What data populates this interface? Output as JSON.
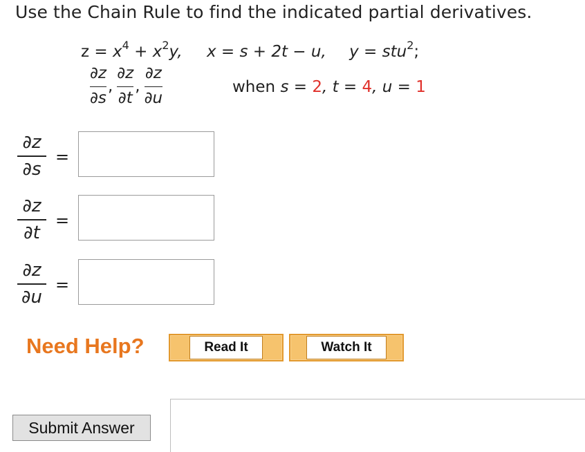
{
  "prompt": "Use the Chain Rule to find the indicated partial derivatives.",
  "given": {
    "z_lhs": "z = ",
    "z_x": "x",
    "z_exp4": "4",
    "z_plus": " + ",
    "z_x2": "x",
    "z_exp2": "2",
    "z_y": "y,",
    "x_def": "x = s + 2t − u,",
    "y_def_lhs": "y = ",
    "y_def_stu": "stu",
    "y_def_exp": "2",
    "y_def_end": ";"
  },
  "partials": {
    "dz": "∂z",
    "ds": "∂s",
    "dt": "∂t",
    "du": "∂u",
    "comma": ","
  },
  "when": {
    "label": "when ",
    "s_lbl": "s = ",
    "s_val": "2",
    "t_lbl": ", t = ",
    "t_val": "4",
    "u_lbl": ", u = ",
    "u_val": "1"
  },
  "answers": [
    {
      "num": "∂z",
      "den": "∂s",
      "equals": "=",
      "value": ""
    },
    {
      "num": "∂z",
      "den": "∂t",
      "equals": "=",
      "value": ""
    },
    {
      "num": "∂z",
      "den": "∂u",
      "equals": "=",
      "value": ""
    }
  ],
  "help": {
    "need_help": "Need Help?",
    "read_it": "Read It",
    "watch_it": "Watch It"
  },
  "submit_label": "Submit Answer",
  "colors": {
    "accent_red": "#e0302a",
    "help_orange": "#e8771f",
    "button_orange": "#f6c36d"
  }
}
